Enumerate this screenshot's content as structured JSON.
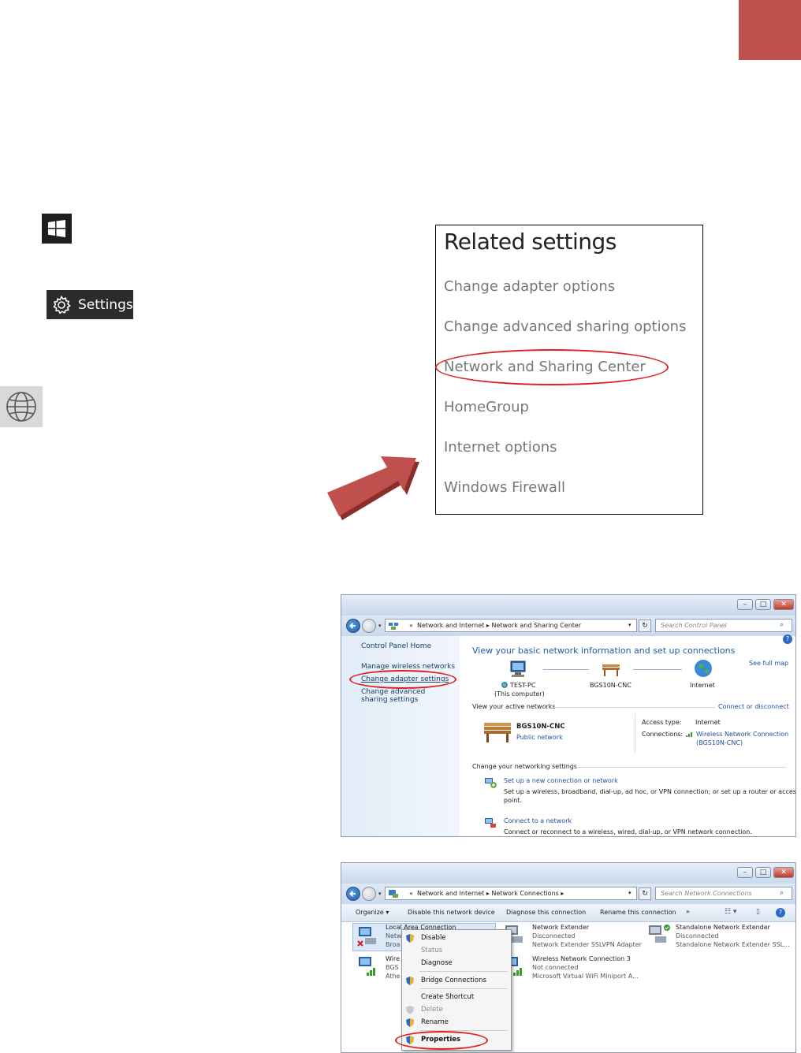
{
  "related_settings": {
    "title": "Related settings",
    "links": [
      "Change adapter options",
      "Change advanced sharing options",
      "Network and Sharing Center",
      "HomeGroup",
      "Internet options",
      "Windows Firewall"
    ]
  },
  "settings_button": {
    "label": "Settings"
  },
  "colors": {
    "accent_block": "#c0504d",
    "highlight_oval": "#e02020",
    "arrow": "#c0504d"
  },
  "window1": {
    "breadcrumb": [
      "Network and Internet",
      "Network and Sharing Center"
    ],
    "breadcrumb_prefix": "«",
    "search_placeholder": "Search Control Panel",
    "left_pane": {
      "home": "Control Panel Home",
      "items": [
        "Manage wireless networks",
        "Change adapter settings",
        "Change advanced sharing settings"
      ]
    },
    "heading": "View your basic network information and set up connections",
    "see_full_map": "See full map",
    "map": {
      "pc": "TEST-PC",
      "pc_sub": "(This computer)",
      "router": "BGS10N-CNC",
      "internet": "Internet"
    },
    "active_networks_label": "View your active networks",
    "connect_disconnect": "Connect or disconnect",
    "network": {
      "name": "BGS10N-CNC",
      "type": "Public network"
    },
    "access_type_label": "Access type:",
    "access_type_value": "Internet",
    "connections_label": "Connections:",
    "connections_value": "Wireless Network Connection",
    "connections_value2": "(BGS10N-CNC)",
    "change_settings_label": "Change your networking settings",
    "tasks": [
      {
        "title": "Set up a new connection or network",
        "desc": "Set up a wireless, broadband, dial-up, ad hoc, or VPN connection; or set up a router or access",
        "desc2": "point."
      },
      {
        "title": "Connect to a network",
        "desc": "Connect or reconnect to a wireless, wired, dial-up, or VPN network connection.",
        "desc2": ""
      }
    ]
  },
  "window2": {
    "breadcrumb": [
      "Network and Internet",
      "Network Connections"
    ],
    "breadcrumb_prefix": "«",
    "search_placeholder": "Search Network Connections",
    "toolbar": [
      "Organize ▾",
      "Disable this network device",
      "Diagnose this connection",
      "Rename this connection",
      "»"
    ],
    "adapters": [
      {
        "name": "Local Area Connection",
        "l2": "Netw",
        "l3": "Broa"
      },
      {
        "name": "Wire",
        "l2": "BGS",
        "l3": "Athe"
      },
      {
        "name": "Network Extender",
        "l2": "Disconnected",
        "l3": "Network Extender SSLVPN Adapter"
      },
      {
        "name": "Wireless Network Connection 3",
        "l2": "Not connected",
        "l3": "Microsoft Virtual WiFi Miniport A..."
      },
      {
        "name": "Standalone Network Extender",
        "l2": "Disconnected",
        "l3": "Standalone Network Extender SSL..."
      }
    ],
    "context_menu": [
      "Disable",
      "Status",
      "Diagnose",
      "Bridge Connections",
      "Create Shortcut",
      "Delete",
      "Rename",
      "Properties"
    ]
  }
}
